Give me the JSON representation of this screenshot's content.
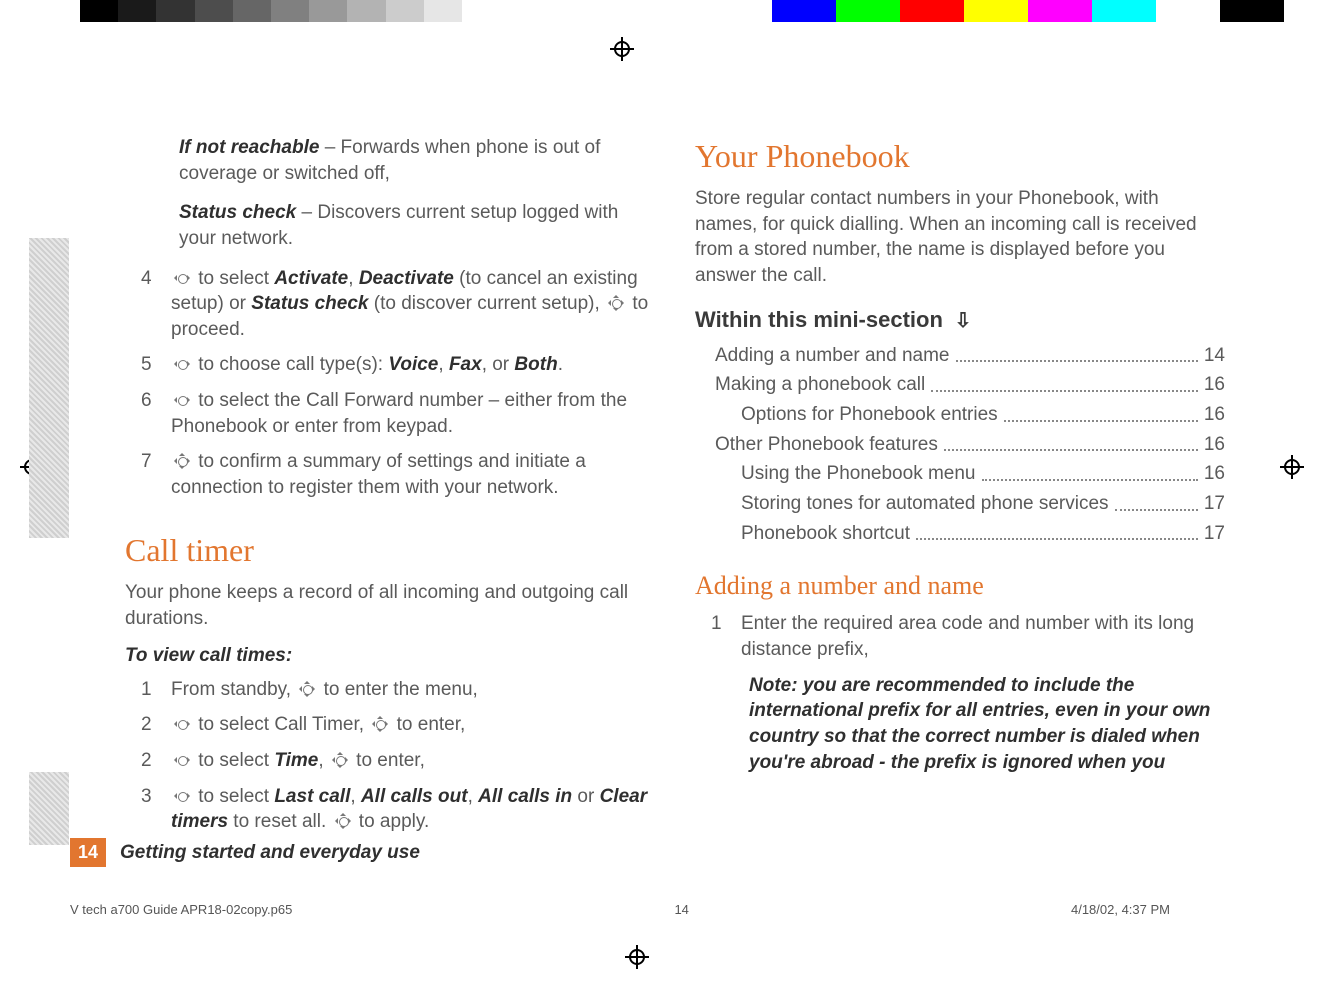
{
  "left": {
    "ifNotReachable": {
      "label": "If not reachable",
      "text": " – Forwards when phone is out of coverage or switched off,"
    },
    "statusCheck": {
      "label": "Status check",
      "text": " – Discovers current setup logged with your network."
    },
    "step4": {
      "n": "4",
      "a": " to select ",
      "b": "Activate",
      "c": ", ",
      "d": "Deactivate",
      "e": " (to cancel an existing setup) or ",
      "f": "Status check",
      "g": " (to discover current setup), ",
      "h": " to proceed."
    },
    "step5": {
      "n": "5",
      "a": " to choose call type(s): ",
      "b": "Voice",
      "c": ", ",
      "d": "Fax",
      "e": ", or ",
      "f": "Both",
      "g": "."
    },
    "step6": {
      "n": "6",
      "a": " to select the Call Forward number – either from the Phonebook or enter from keypad."
    },
    "step7": {
      "n": "7",
      "a": " to confirm a summary of settings and initiate a connection to register them with your network."
    },
    "callTimerHeading": "Call timer",
    "callTimerIntro": "Your phone keeps a record of all incoming and outgoing call durations.",
    "toViewHeading": "To view call times:",
    "ct1": {
      "n": "1",
      "a": "From standby, ",
      "b": " to enter the menu,"
    },
    "ct2": {
      "n": "2",
      "a": " to select Call Timer, ",
      "b": " to enter,"
    },
    "ct2b": {
      "n": "2",
      "a": " to select ",
      "b": "Time",
      "c": ", ",
      "d": " to enter,"
    },
    "ct3": {
      "n": "3",
      "a": " to select ",
      "b": "Last call",
      "c": ", ",
      "d": "All calls out",
      "e": ", ",
      "f": "All calls in",
      "g": " or ",
      "h": "Clear timers",
      "i": " to reset all. ",
      "j": " to apply."
    }
  },
  "right": {
    "heading": "Your Phonebook",
    "intro": "Store regular contact numbers in your Phonebook, with names, for quick dialling. When an incoming call is received from a stored number, the name is displayed before you answer the call.",
    "miniHeading": "Within this mini-section",
    "toc": [
      {
        "t": "Adding a number and name",
        "p": "14",
        "sub": false
      },
      {
        "t": "Making a phonebook call",
        "p": "16",
        "sub": false
      },
      {
        "t": "Options for Phonebook entries",
        "p": "16",
        "sub": true
      },
      {
        "t": "Other Phonebook features",
        "p": "16",
        "sub": false
      },
      {
        "t": "Using the Phonebook menu",
        "p": "16",
        "sub": true
      },
      {
        "t": "Storing tones for automated phone services",
        "p": "17",
        "sub": true
      },
      {
        "t": "Phonebook shortcut",
        "p": "17",
        "sub": true
      }
    ],
    "addHeading": "Adding a number and name",
    "add1": {
      "n": "1",
      "a": "Enter the required area code and number with its long distance prefix,"
    },
    "note": "Note: you are recommended to include the international prefix for all entries, even in your own country so that the correct number is dialed when you're abroad - the prefix is ignored when you"
  },
  "footer": {
    "pageNum": "14",
    "title": "Getting started and everyday use",
    "file": "V tech a700 Guide APR18-02copy.p65",
    "filePage": "14",
    "timestamp": "4/18/02, 4:37 PM"
  },
  "bars": {
    "grays": [
      "#000000",
      "#1a1a1a",
      "#333333",
      "#4d4d4d",
      "#666666",
      "#808080",
      "#999999",
      "#b3b3b3",
      "#cccccc",
      "#e6e6e6",
      "#ffffff"
    ],
    "colors": [
      "#0000ff",
      "#00ff00",
      "#ff0000",
      "#ffff00",
      "#ff00ff",
      "#00ffff",
      "#ffffff",
      "#000000"
    ]
  }
}
